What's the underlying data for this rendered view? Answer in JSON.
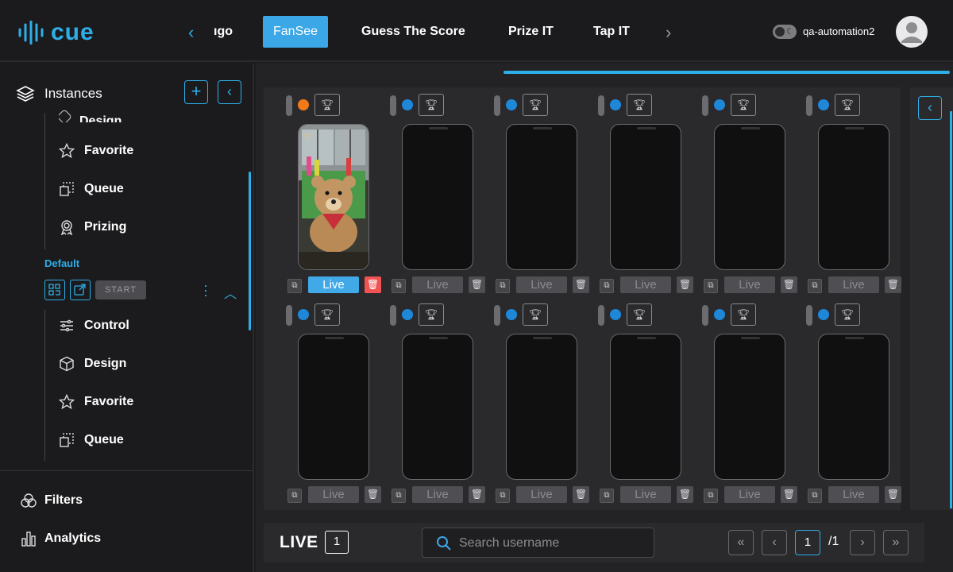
{
  "brand": {
    "name": "cue",
    "color": "#2eaee8"
  },
  "nav": {
    "tabs": [
      {
        "label": "ıgo"
      },
      {
        "label": "FanSee"
      },
      {
        "label": "Guess The Score"
      },
      {
        "label": "Prize IT"
      },
      {
        "label": "Tap IT"
      }
    ],
    "active": "FanSee"
  },
  "user": {
    "name": "qa-automation2",
    "theme_toggle": "dark"
  },
  "sidebar": {
    "header": "Instances",
    "partial_item": "Design",
    "group_a": [
      "Favorite",
      "Queue",
      "Prizing"
    ],
    "default_label": "Default",
    "start_label": "START",
    "group_b": [
      "Control",
      "Design",
      "Favorite",
      "Queue"
    ],
    "footer": [
      "Filters",
      "Analytics"
    ]
  },
  "grid": {
    "live_label": "Live",
    "status_colors": {
      "active": "#f07a1a",
      "idle": "#1e87d8"
    },
    "first_cell_active": true
  },
  "bottom": {
    "live_title": "LIVE",
    "live_count": "1",
    "search_placeholder": "Search username",
    "current_page": "1",
    "total_pages": "/1"
  }
}
